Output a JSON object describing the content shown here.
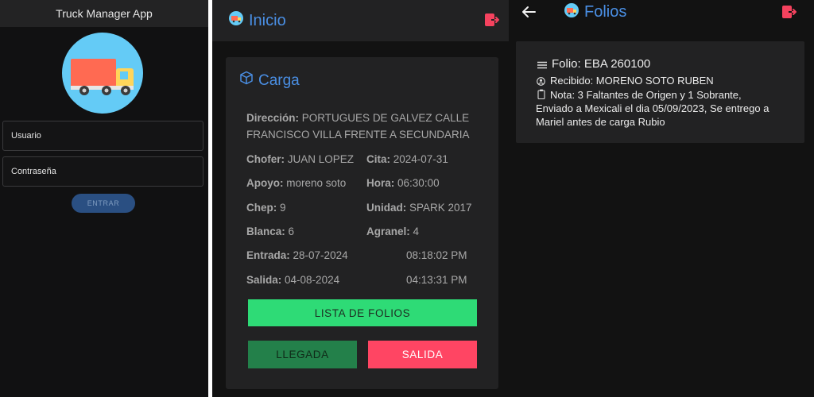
{
  "login": {
    "app_title": "Truck Manager App",
    "logo_icon": "truck-logo-icon",
    "username_placeholder": "Usuario",
    "password_placeholder": "Contraseña",
    "enter_label": "ENTRAR"
  },
  "inicio": {
    "title": "Inicio",
    "logout_icon": "logout-icon",
    "card": {
      "title": "Carga",
      "icon": "cube-icon",
      "direccion_label": "Dirección:",
      "direccion_line1": "PORTUGUES DE GALVEZ CALLE",
      "direccion_line2": "FRANCISCO VILLA FRENTE A SECUNDARIA",
      "chofer_label": "Chofer:",
      "chofer_value": "JUAN LOPEZ",
      "cita_label": "Cita:",
      "cita_value": "2024-07-31",
      "apoyo_label": "Apoyo:",
      "apoyo_value": "moreno soto",
      "hora_label": "Hora:",
      "hora_value": "06:30:00",
      "chep_label": "Chep:",
      "chep_value": "9",
      "unidad_label": "Unidad:",
      "unidad_value": "SPARK 2017",
      "blanca_label": "Blanca:",
      "blanca_value": "6",
      "agranel_label": "Agranel:",
      "agranel_value": "4",
      "entrada_label": "Entrada:",
      "entrada_date": "28-07-2024",
      "entrada_time": "08:18:02 PM",
      "salida_label": "Salida:",
      "salida_date": "04-08-2024",
      "salida_time": "04:13:31 PM"
    },
    "buttons": {
      "lista": "LISTA DE FOLIOS",
      "llegada": "LLEGADA",
      "salida": "SALIDA"
    },
    "colors": {
      "accent": "#4a8fe4",
      "lista_bg": "#2edb76",
      "llegada_bg": "#23804a",
      "salida_bg": "#ff4563",
      "logout": "#f5425e"
    }
  },
  "folios": {
    "title": "Folios",
    "back_icon": "arrow-left-icon",
    "folio_label": "Folio: EBA 260100",
    "recibido": "Recibido: MORENO SOTO RUBEN",
    "nota_line1": "Nota: 3 Faltantes de Origen y 1 Sobrante,",
    "nota_line2": "Enviado a Mexicali el dia 05/09/2023, Se entrego a",
    "nota_line3": "Mariel antes de carga Rubio"
  }
}
